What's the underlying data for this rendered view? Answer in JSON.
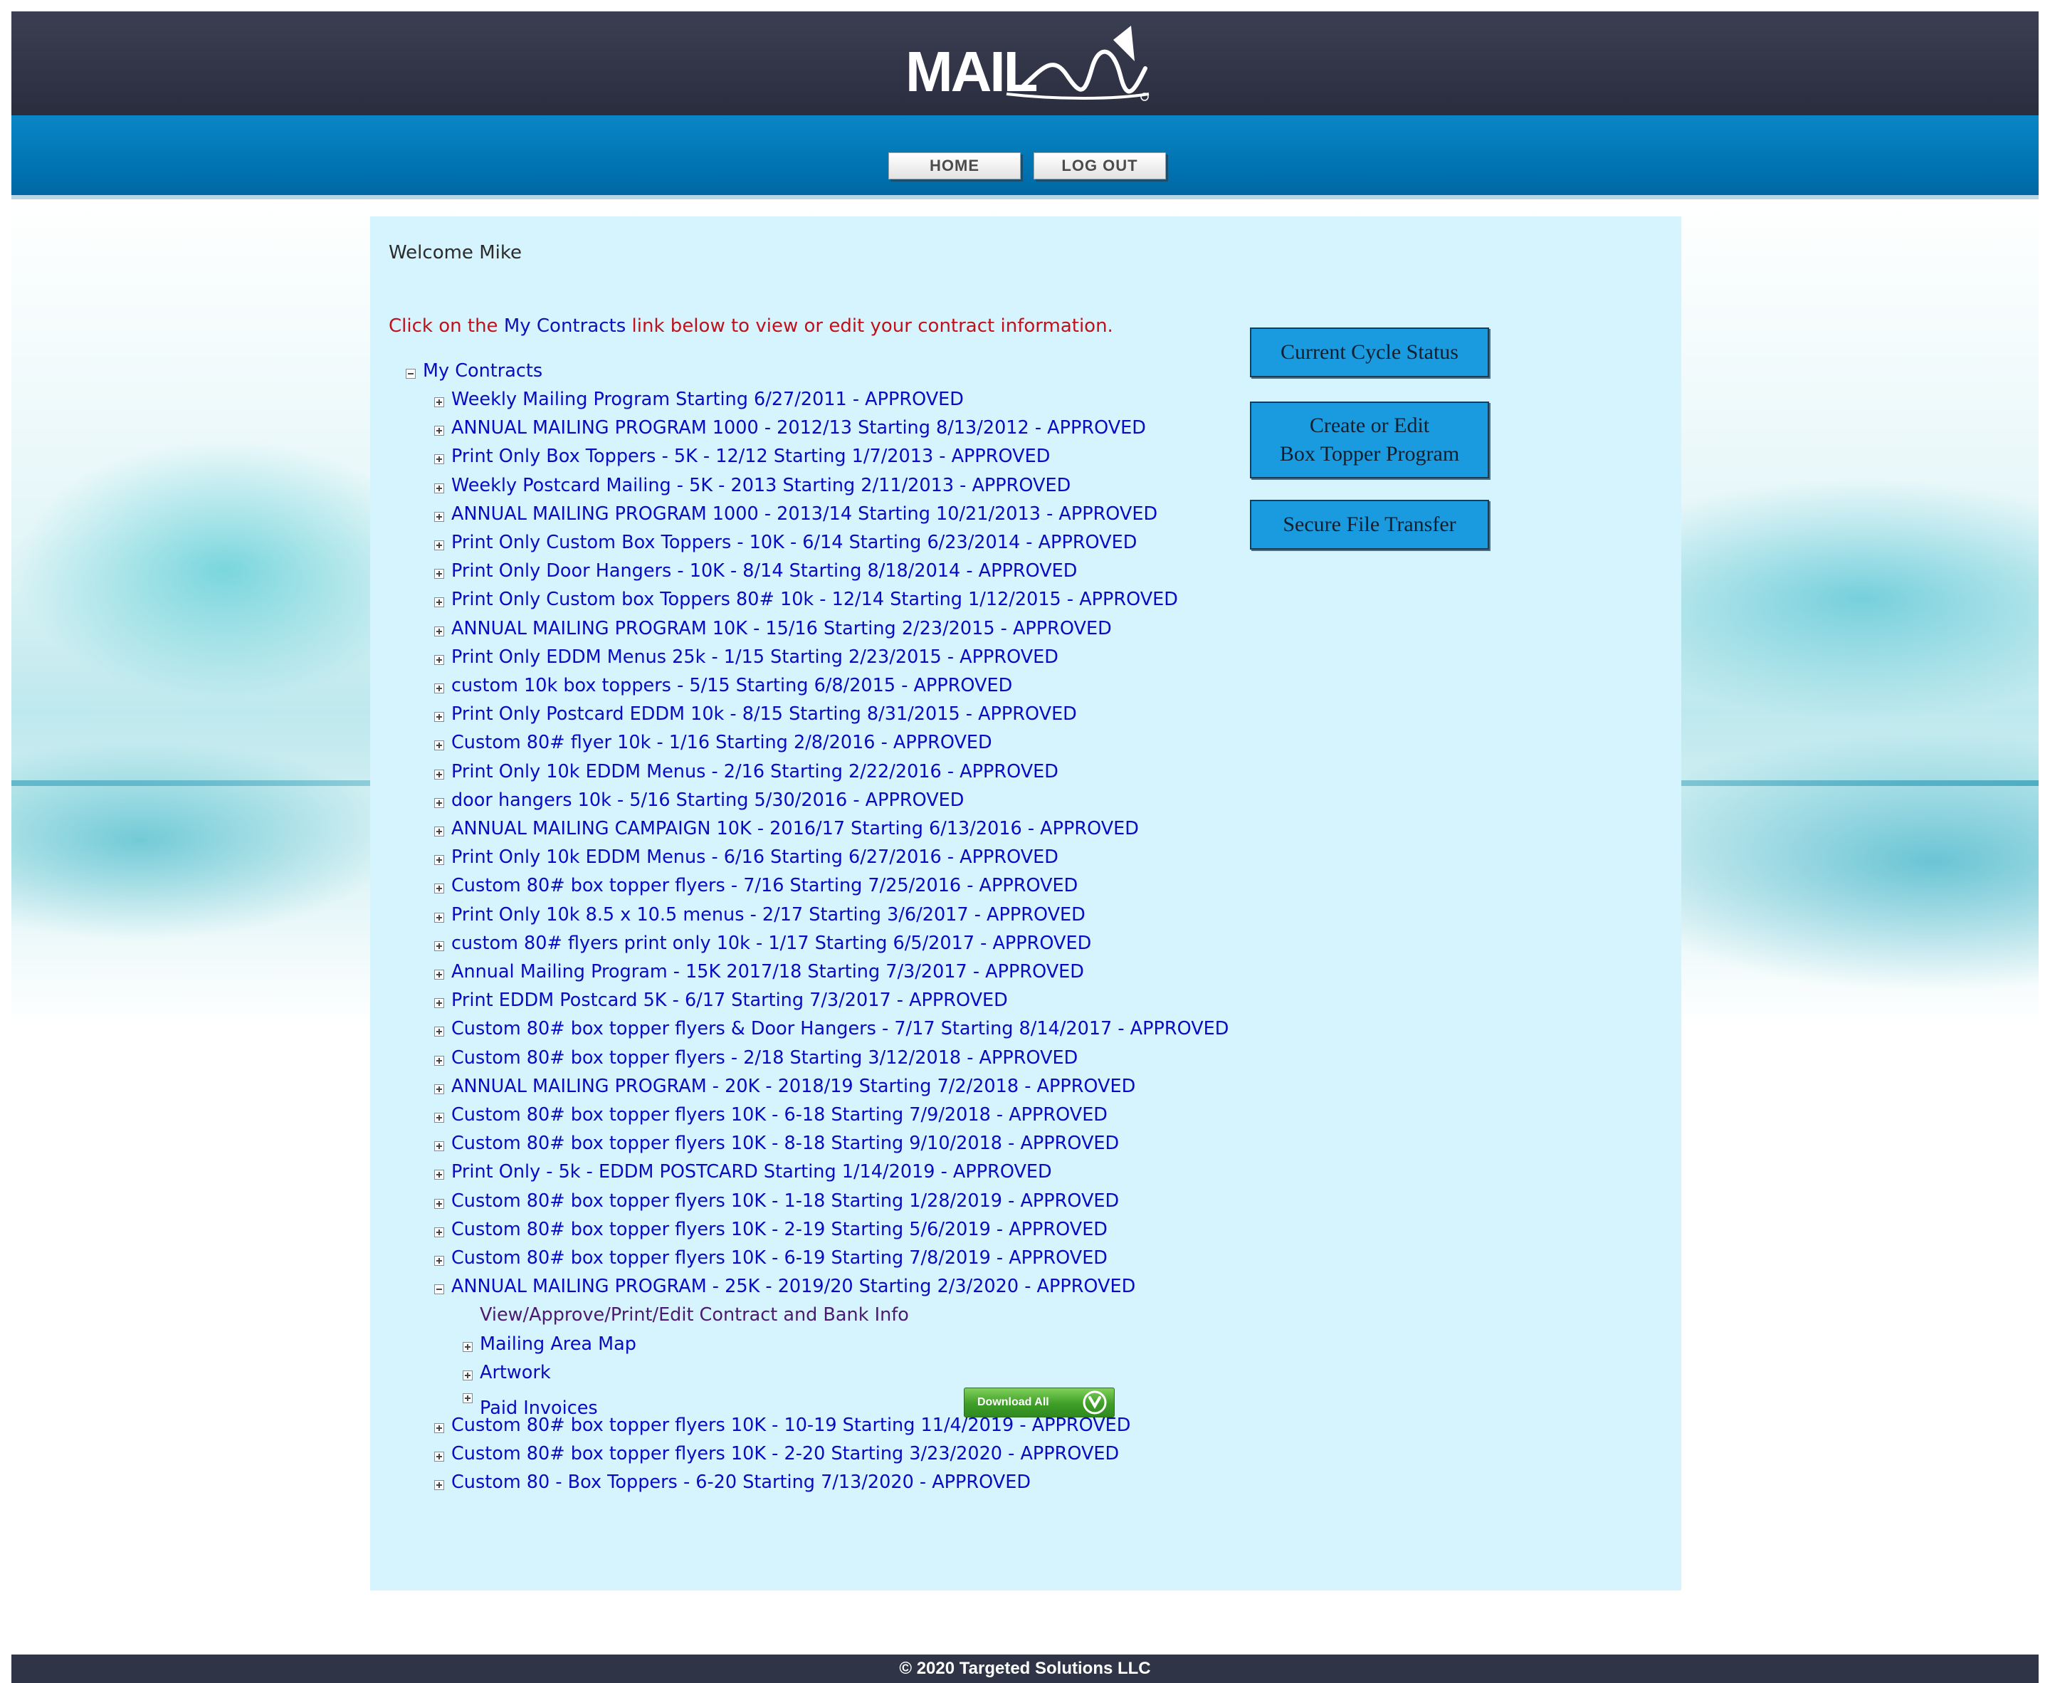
{
  "header": {
    "logo_text": "MAILShark",
    "nav": {
      "home": "HOME",
      "logout": "LOG OUT"
    }
  },
  "welcome": "Welcome Mike",
  "intro": {
    "before": "Click on the ",
    "link": "My Contracts",
    "after": " link below to view or edit your contract information."
  },
  "tree": {
    "root": "My Contracts",
    "contracts": [
      "Weekly Mailing Program Starting 6/27/2011 - APPROVED",
      "ANNUAL MAILING PROGRAM 1000 - 2012/13 Starting 8/13/2012 - APPROVED",
      "Print Only Box Toppers - 5K - 12/12 Starting 1/7/2013 - APPROVED",
      "Weekly Postcard Mailing - 5K - 2013 Starting 2/11/2013 - APPROVED",
      "ANNUAL MAILING PROGRAM 1000 - 2013/14 Starting 10/21/2013 - APPROVED",
      "Print Only Custom Box Toppers - 10K - 6/14 Starting 6/23/2014 - APPROVED",
      "Print Only Door Hangers - 10K - 8/14 Starting 8/18/2014 - APPROVED",
      "Print Only Custom box Toppers 80# 10k - 12/14 Starting 1/12/2015 - APPROVED",
      "ANNUAL MAILING PROGRAM 10K - 15/16 Starting 2/23/2015 - APPROVED",
      "Print Only EDDM Menus 25k - 1/15 Starting 2/23/2015 - APPROVED",
      "custom 10k box toppers - 5/15 Starting 6/8/2015 - APPROVED",
      "Print Only Postcard EDDM 10k - 8/15 Starting 8/31/2015 - APPROVED",
      "Custom 80# flyer 10k - 1/16 Starting 2/8/2016 - APPROVED",
      "Print Only 10k EDDM Menus - 2/16 Starting 2/22/2016 - APPROVED",
      "door hangers 10k - 5/16 Starting 5/30/2016 - APPROVED",
      "ANNUAL MAILING CAMPAIGN 10K - 2016/17 Starting 6/13/2016 - APPROVED",
      "Print Only 10k EDDM Menus - 6/16 Starting 6/27/2016 - APPROVED",
      "Custom 80# box topper flyers - 7/16 Starting 7/25/2016 - APPROVED",
      "Print Only 10k 8.5 x 10.5 menus - 2/17 Starting 3/6/2017 - APPROVED",
      "custom 80# flyers print only 10k - 1/17 Starting 6/5/2017 - APPROVED",
      "Annual Mailing Program - 15K 2017/18 Starting 7/3/2017 - APPROVED",
      "Print EDDM Postcard 5K - 6/17 Starting 7/3/2017 - APPROVED",
      "Custom 80# box topper flyers & Door Hangers - 7/17 Starting 8/14/2017 - APPROVED",
      "Custom 80# box topper flyers - 2/18 Starting 3/12/2018 - APPROVED",
      "ANNUAL MAILING PROGRAM - 20K - 2018/19 Starting 7/2/2018 - APPROVED",
      "Custom 80# box topper flyers 10K - 6-18 Starting 7/9/2018 - APPROVED",
      "Custom 80# box topper flyers 10K - 8-18 Starting 9/10/2018 - APPROVED",
      "Print Only - 5k - EDDM POSTCARD Starting 1/14/2019 - APPROVED",
      "Custom 80# box topper flyers 10K - 1-18 Starting 1/28/2019 - APPROVED",
      "Custom 80# box topper flyers 10K - 2-19 Starting 5/6/2019 - APPROVED",
      "Custom 80# box topper flyers 10K - 6-19 Starting 7/8/2019 - APPROVED"
    ],
    "expanded": {
      "label": "ANNUAL MAILING PROGRAM - 25K - 2019/20 Starting 2/3/2020 - APPROVED",
      "view_link": "View/Approve/Print/Edit Contract and Bank Info",
      "children": [
        "Mailing Area Map",
        "Artwork",
        "Paid Invoices"
      ],
      "download_label": "Download All"
    },
    "contracts_after": [
      "Custom 80# box topper flyers 10K - 10-19 Starting 11/4/2019 - APPROVED",
      "Custom 80# box topper flyers 10K - 2-20 Starting 3/23/2020 - APPROVED",
      "Custom 80 - Box Toppers - 6-20 Starting 7/13/2020 - APPROVED"
    ]
  },
  "side_buttons": {
    "cycle_status": "Current Cycle Status",
    "box_topper_line1": "Create or Edit",
    "box_topper_line2": "Box Topper Program",
    "file_transfer": "Secure File Transfer"
  },
  "footer": "© 2020 Targeted Solutions LLC"
}
